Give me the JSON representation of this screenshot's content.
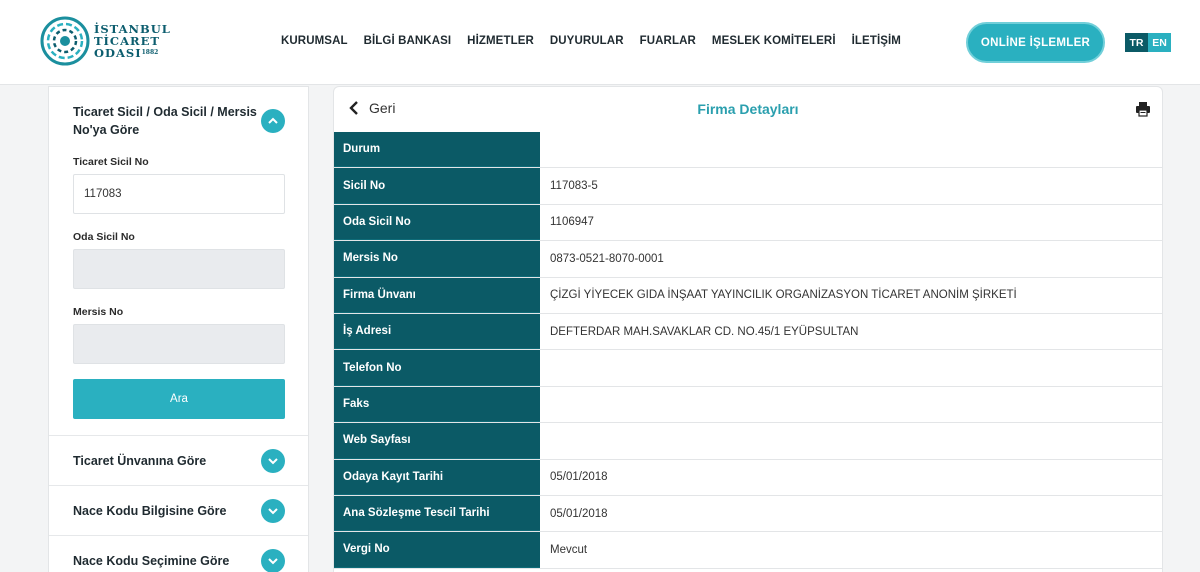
{
  "header": {
    "logo_lines": [
      "İSTANBUL",
      "TİCARET",
      "ODASI"
    ],
    "logo_year": "1882",
    "nav": [
      "KURUMSAL",
      "BİLGİ BANKASI",
      "HİZMETLER",
      "DUYURULAR",
      "FUARLAR",
      "MESLEK KOMİTELERİ",
      "İLETİŞİM"
    ],
    "online_button": "ONLİNE İŞLEMLER",
    "lang": [
      "TR",
      "EN"
    ]
  },
  "sidebar": {
    "open_section": {
      "title": "Ticaret Sicil / Oda Sicil / Mersis No'ya Göre",
      "fields": [
        {
          "label": "Ticaret Sicil No",
          "value": "117083"
        },
        {
          "label": "Oda Sicil No",
          "value": ""
        },
        {
          "label": "Mersis No",
          "value": ""
        }
      ],
      "search_button": "Ara"
    },
    "sections": [
      "Ticaret Ünvanına Göre",
      "Nace Kodu Bilgisine Göre",
      "Nace Kodu Seçimine Göre"
    ]
  },
  "panel": {
    "back_label": "Geri",
    "title": "Firma Detayları",
    "icons": {
      "back": "chevron-left-icon",
      "print": "printer-icon"
    },
    "rows": [
      {
        "key": "Durum",
        "value": ""
      },
      {
        "key": "Sicil No",
        "value": "117083-5"
      },
      {
        "key": "Oda Sicil No",
        "value": "1106947"
      },
      {
        "key": "Mersis No",
        "value": "0873-0521-8070-0001"
      },
      {
        "key": "Firma Ünvanı",
        "value": "ÇİZGİ YİYECEK GIDA İNŞAAT YAYINCILIK ORGANİZASYON TİCARET ANONİM ŞİRKETİ"
      },
      {
        "key": "İş Adresi",
        "value": "DEFTERDAR MAH.SAVAKLAR CD. NO.45/1 EYÜPSULTAN"
      },
      {
        "key": "Telefon No",
        "value": ""
      },
      {
        "key": "Faks",
        "value": ""
      },
      {
        "key": "Web Sayfası",
        "value": ""
      },
      {
        "key": "Odaya Kayıt Tarihi",
        "value": "05/01/2018"
      },
      {
        "key": "Ana Sözleşme Tescil Tarihi",
        "value": "05/01/2018"
      },
      {
        "key": "Vergi No",
        "value": "Mevcut"
      }
    ]
  },
  "colors": {
    "teal": "#2ab0c0",
    "dark_teal": "#0b5a66",
    "title_teal": "#2a9fae"
  }
}
